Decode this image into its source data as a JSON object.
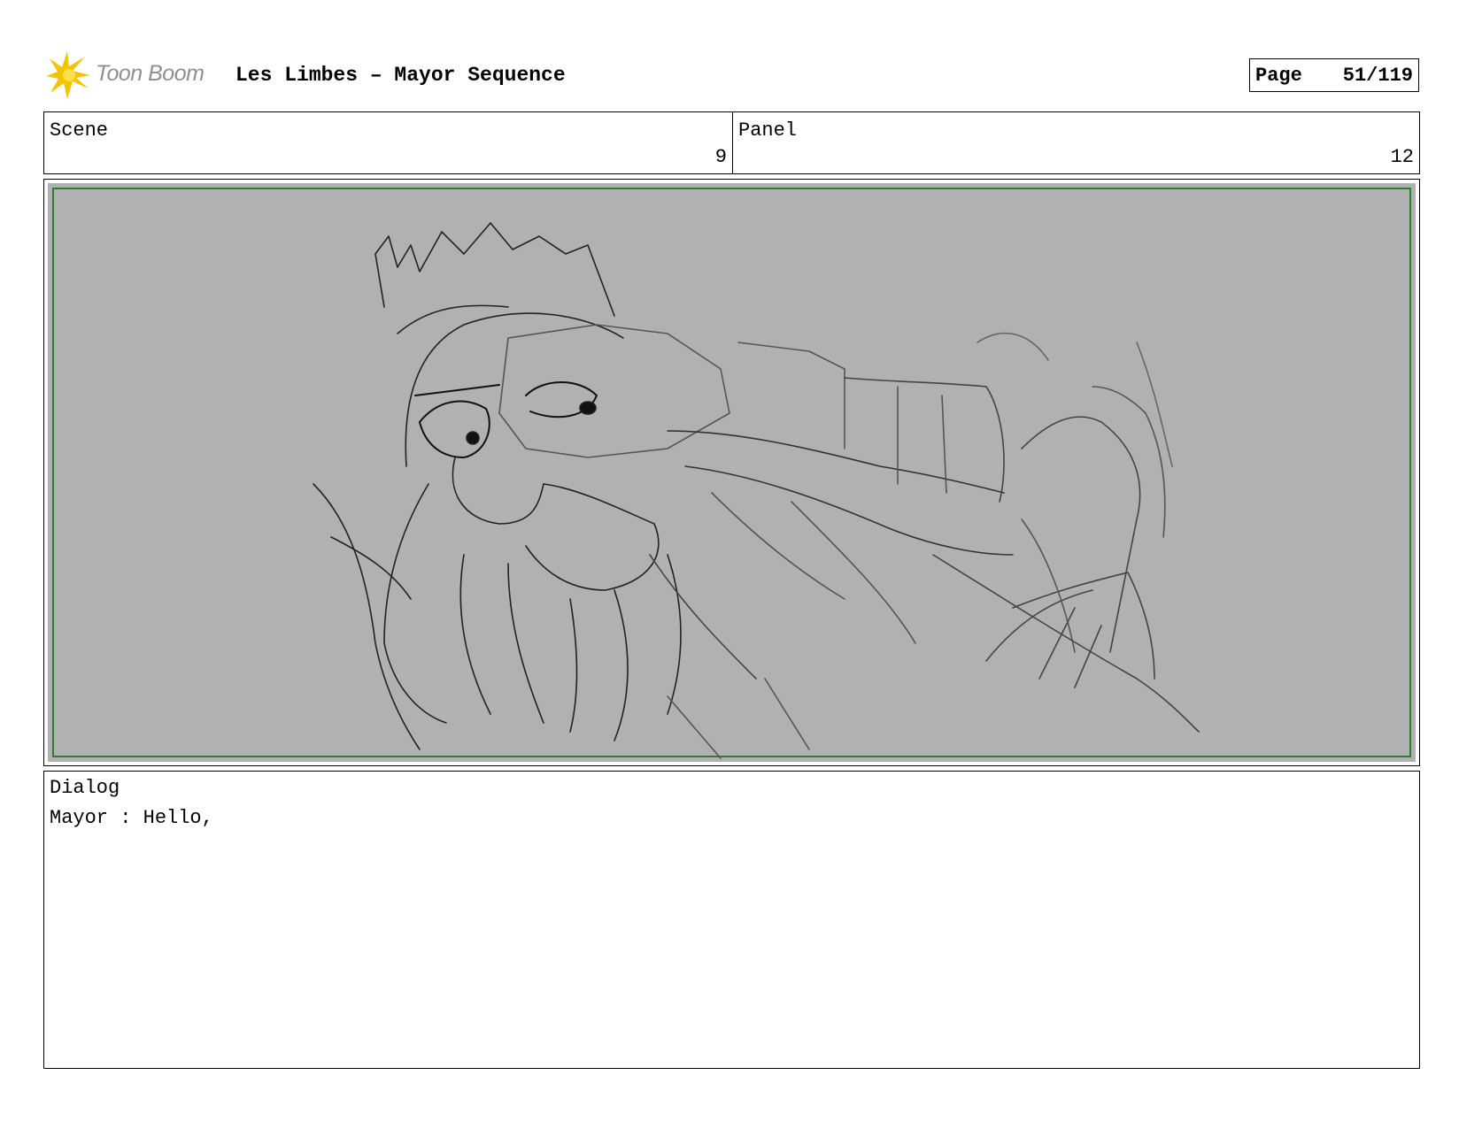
{
  "header": {
    "logo_text": "Toon Boom",
    "title": "Les Limbes – Mayor Sequence",
    "page_label": "Page",
    "page_value": "51/119"
  },
  "info": {
    "scene_label": "Scene",
    "scene_value": "9",
    "panel_label": "Panel",
    "panel_value": "12"
  },
  "dialog": {
    "label": "Dialog",
    "text": "Mayor : Hello,"
  },
  "colors": {
    "logo_yellow": "#f5c400",
    "panel_background": "#b1b1b1",
    "safe_frame": "#2e7d32",
    "sketch_line": "#1a1a1a"
  }
}
